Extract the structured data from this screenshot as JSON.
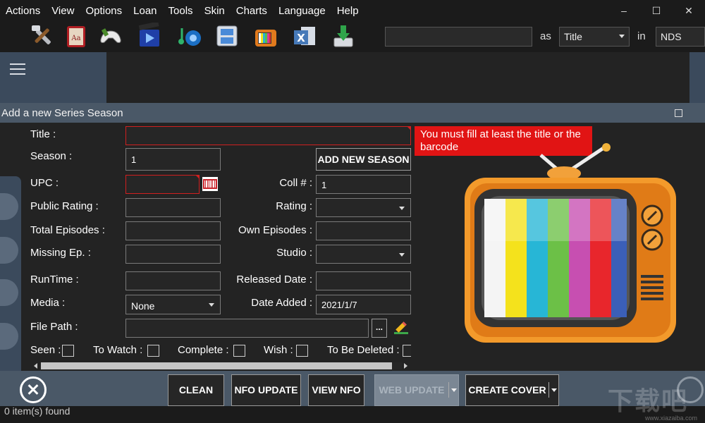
{
  "menu": [
    "Actions",
    "View",
    "Options",
    "Loan",
    "Tools",
    "Skin",
    "Charts",
    "Language",
    "Help"
  ],
  "window_controls": {
    "minimize": "–",
    "maximize": "☐",
    "close": "✕"
  },
  "toolbar_icons": [
    "tools-icon",
    "book-icon",
    "gamepad-icon",
    "film-icon",
    "music-icon",
    "nds-icon",
    "tv-icon",
    "excel-icon",
    "download-icon"
  ],
  "search": {
    "value": "",
    "as_label": "as",
    "field_value": "Title",
    "in_label": "in",
    "in_value": "NDS"
  },
  "status": {
    "text": "0 item(s) found"
  },
  "dialog": {
    "title": "Add a new Series Season",
    "labels": {
      "title": "Title :",
      "season": "Season :",
      "upc": "UPC :",
      "coll": "Coll # :",
      "public_rating": "Public Rating :",
      "rating": "Rating :",
      "total_episodes": "Total Episodes :",
      "own_episodes": "Own Episodes :",
      "missing_ep": "Missing Ep. :",
      "studio": "Studio :",
      "runtime": "RunTime :",
      "released_date": "Released Date :",
      "media": "Media :",
      "date_added": "Date Added :",
      "file_path": "File Path :"
    },
    "values": {
      "title": "",
      "season": "1",
      "upc": "",
      "coll": "1",
      "public_rating": "",
      "rating": "",
      "total_episodes": "",
      "own_episodes": "",
      "missing_ep": "",
      "studio": "",
      "runtime": "",
      "released_date": "",
      "media": "None",
      "date_added": "2021/1/7",
      "file_path": ""
    },
    "add_new_season": "ADD NEW SEASON",
    "browse": "...",
    "tooltip": "You must fill at least the title or the barcode",
    "checks": [
      {
        "label": "Seen :",
        "checked": false
      },
      {
        "label": "To Watch :",
        "checked": false
      },
      {
        "label": "Complete :",
        "checked": false
      },
      {
        "label": "Wish :",
        "checked": false
      },
      {
        "label": "To Be Deleted :",
        "checked": false
      }
    ],
    "buttons": {
      "clean": "CLEAN",
      "nfo_update": "NFO UPDATE",
      "view_nfo": "VIEW NFO",
      "web_update": "WEB UPDATE",
      "create_cover": "CREATE COVER"
    }
  },
  "watermark": {
    "text": "下载吧",
    "url": "www.xiazaiba.com"
  },
  "colors": {
    "accent_bar": "#4a5867",
    "error": "#e11414",
    "background": "#232323"
  }
}
